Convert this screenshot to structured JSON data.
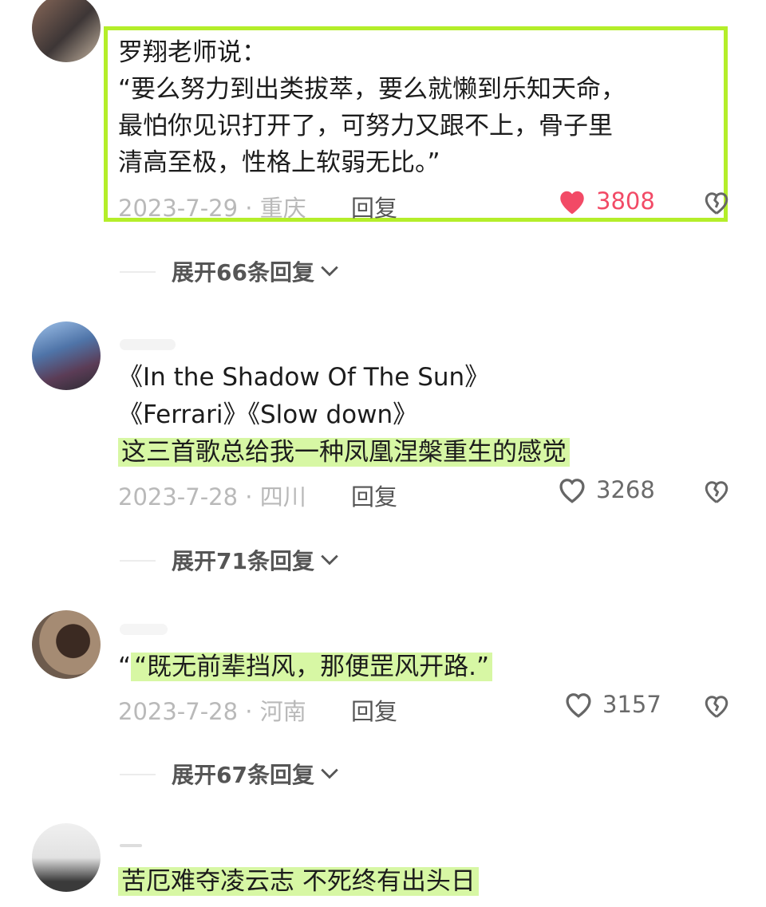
{
  "comments": [
    {
      "lines": [
        "罗翔老师说：",
        "“要么努力到出类拔萃，要么就懒到乐知天命，",
        "最怕你见识打开了，可努力又跟不上，骨子里",
        "清高至极，性格上软弱无比。”"
      ],
      "date_loc": "2023-7-29 · 重庆",
      "reply_label": "回复",
      "likes": "3808",
      "liked": true,
      "expand_label": "展开66条回复"
    },
    {
      "lines": [
        "《In the Shadow Of The Sun》",
        "《Ferrari》《Slow down》",
        "这三首歌总给我一种凤凰涅槃重生的感觉"
      ],
      "date_loc": "2023-7-28 · 四川",
      "reply_label": "回复",
      "likes": "3268",
      "liked": false,
      "expand_label": "展开71条回复"
    },
    {
      "lines": [
        "“既无前辈挡风，那便罡风开路.”"
      ],
      "date_loc": "2023-7-28 · 河南",
      "reply_label": "回复",
      "likes": "3157",
      "liked": false,
      "expand_label": "展开67条回复"
    },
    {
      "lines": [
        "苦厄难夺凌云志 不死终有出头日"
      ]
    }
  ],
  "colors": {
    "highlight_border": "#b4ee2a",
    "highlight_fill": "#d7f7a4",
    "liked_red": "#f24a66"
  },
  "icons": [
    "heart-icon",
    "heart-outline-icon",
    "broken-heart-icon",
    "chevron-down-icon"
  ]
}
